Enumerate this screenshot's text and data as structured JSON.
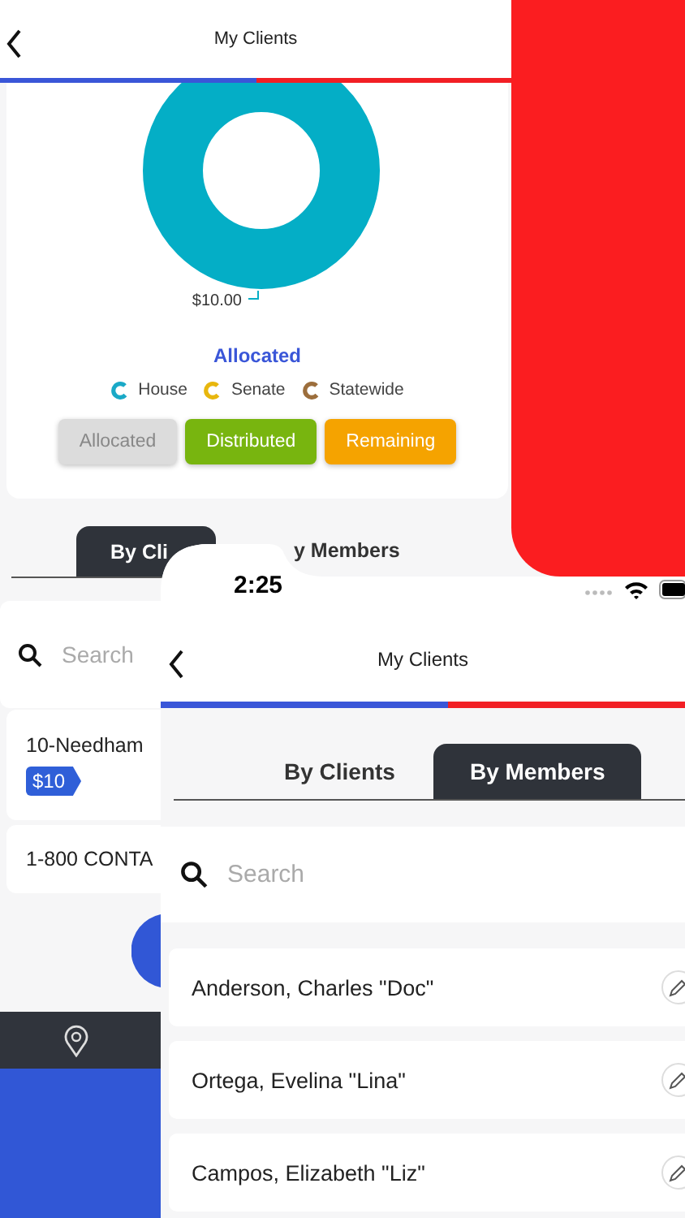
{
  "back_screen": {
    "title": "My Clients",
    "donut": {
      "value_label": "$10.00",
      "title": "Allocated"
    },
    "legend": [
      {
        "label": "House",
        "color": "#1aa9c7"
      },
      {
        "label": "Senate",
        "color": "#e8b70e"
      },
      {
        "label": "Statewide",
        "color": "#9c6e3c"
      }
    ],
    "filters": [
      {
        "label": "Allocated",
        "color": "#dcdcdc",
        "disabled": true
      },
      {
        "label": "Distributed",
        "color": "#78b50f",
        "disabled": false
      },
      {
        "label": "Remaining",
        "color": "#f5a300",
        "disabled": false
      }
    ],
    "tabs": [
      {
        "label": "By Cli",
        "selected": true
      },
      {
        "label": "y Members",
        "selected": false
      }
    ],
    "search": {
      "placeholder": "Search"
    },
    "clients": [
      {
        "name": "10-Needham",
        "badge": "$10"
      },
      {
        "name": "1-800 CONTA"
      }
    ]
  },
  "front_screen": {
    "time": "2:25",
    "title": "My Clients",
    "tabs": [
      {
        "label": "By Clients",
        "selected": false
      },
      {
        "label": "By Members",
        "selected": true
      }
    ],
    "search": {
      "placeholder": "Search"
    },
    "members": [
      {
        "name": "Anderson, Charles \"Doc\""
      },
      {
        "name": "Ortega, Evelina \"Lina\""
      },
      {
        "name": "Campos, Elizabeth \"Liz\""
      }
    ]
  }
}
